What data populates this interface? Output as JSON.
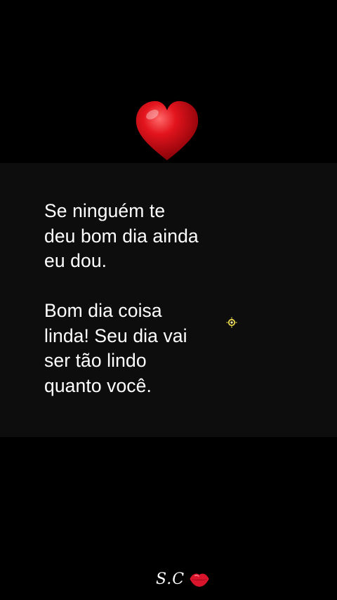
{
  "message": {
    "paragraph1": [
      "Se ninguém te",
      "deu bom dia ainda",
      "eu dou."
    ],
    "paragraph2": [
      "Bom dia coisa",
      "linda! Seu dia vai",
      "ser tão lindo",
      "quanto você."
    ]
  },
  "signature": {
    "text": "S.C"
  },
  "icons": {
    "heart": "red-heart-icon",
    "sparkle": "sparkle-icon",
    "kiss": "kiss-lips-icon"
  },
  "colors": {
    "background": "#000000",
    "panel": "#0d0d0d",
    "text": "#ffffff",
    "heart": "#d4141c",
    "sparkle": "#e7d54a"
  }
}
